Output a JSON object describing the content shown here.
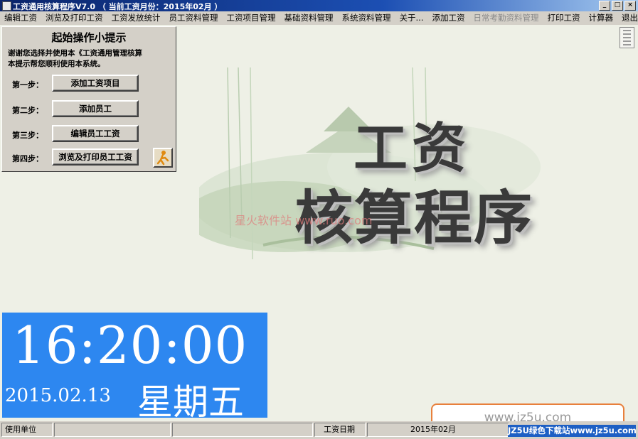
{
  "window": {
    "title": "工资通用核算程序V7.0 （ 当前工资月份：2015年02月 ）",
    "controls": [
      "_",
      "□",
      "×"
    ]
  },
  "menu": {
    "items": [
      {
        "label": "编辑工资",
        "enabled": true
      },
      {
        "label": "浏览及打印工资",
        "enabled": true
      },
      {
        "label": "工资发放统计",
        "enabled": true
      },
      {
        "label": "员工资料管理",
        "enabled": true
      },
      {
        "label": "工资项目管理",
        "enabled": true
      },
      {
        "label": "基础资料管理",
        "enabled": true
      },
      {
        "label": "系统资料管理",
        "enabled": true
      },
      {
        "label": "关于...",
        "enabled": true
      },
      {
        "label": "添加工资",
        "enabled": true
      },
      {
        "label": "日常考勤资料管理",
        "enabled": false
      },
      {
        "label": "打印工资",
        "enabled": true
      },
      {
        "label": "计算器",
        "enabled": true
      },
      {
        "label": "退出本系统",
        "enabled": true
      }
    ]
  },
  "tips": {
    "heading": "起始操作小提示",
    "line1": "谢谢您选择并使用本《工资通用管理核算",
    "line2": "本提示帮您顺利使用本系统。",
    "steps": [
      {
        "label": "第一步：",
        "button": "添加工资项目"
      },
      {
        "label": "第二步：",
        "button": "添加员工"
      },
      {
        "label": "第三步：",
        "button": "编辑员工工资"
      },
      {
        "label": "第四步：",
        "button": "浏览及打印员工工资"
      }
    ]
  },
  "background": {
    "title_line1": "工资",
    "title_line2": "核算程序",
    "site_watermark": "星火软件站 www.ruo.com"
  },
  "clock": {
    "time": "16:20:00",
    "date": "2015.02.13",
    "weekday": "星期五"
  },
  "statusbar": {
    "unit_label": "使用单位",
    "unit_value": "",
    "blank": "",
    "date_label": "工资日期",
    "date_value": "2015年02月"
  },
  "overlay": {
    "bubble_text": "www.jz5u.com",
    "badge_text": "JZ5U绿色下载站www.jz5u.com"
  },
  "colors": {
    "title_bar": "#0a246a",
    "clock_bg": "#2d87f0",
    "bubble_border": "#e8803c"
  }
}
